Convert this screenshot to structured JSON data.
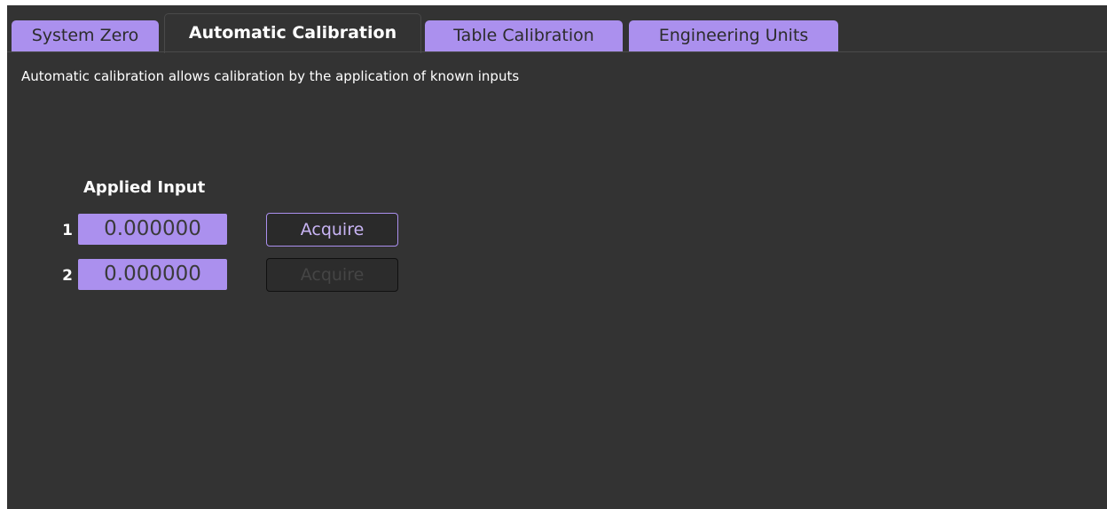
{
  "tabs": [
    {
      "label": "System Zero",
      "active": false
    },
    {
      "label": "Automatic Calibration",
      "active": true
    },
    {
      "label": "Table Calibration",
      "active": false
    },
    {
      "label": "Engineering Units",
      "active": false
    }
  ],
  "description": "Automatic calibration allows calibration by the application of known inputs",
  "applied_input": {
    "header": "Applied Input",
    "rows": [
      {
        "index": "1",
        "value": "0.000000",
        "button_label": "Acquire",
        "button_enabled": true
      },
      {
        "index": "2",
        "value": "0.000000",
        "button_label": "Acquire",
        "button_enabled": false
      }
    ]
  },
  "colors": {
    "accent": "#ab90ee",
    "background": "#333333",
    "text": "#ffffff"
  }
}
